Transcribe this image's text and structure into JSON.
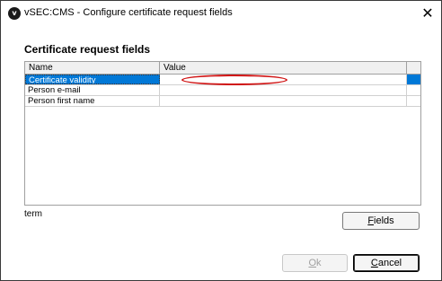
{
  "window": {
    "title": "vSEC:CMS - Configure certificate request fields",
    "app_icon_glyph": "v",
    "close_glyph": "✕"
  },
  "section_title": "Certificate request fields",
  "grid": {
    "columns": [
      "Name",
      "Value",
      ""
    ],
    "rows": [
      {
        "name": "Certificate validity",
        "value": "",
        "selected": true
      },
      {
        "name": "Person e-mail",
        "value": "",
        "selected": false
      },
      {
        "name": "Person first name",
        "value": "",
        "selected": false
      }
    ]
  },
  "status_text": "term",
  "buttons": {
    "fields_first": "F",
    "fields_rest": "ields",
    "ok_first": "O",
    "ok_rest": "k",
    "cancel_first": "C",
    "cancel_rest": "ancel"
  },
  "colors": {
    "selection": "#0078d7",
    "annotation": "#d01414"
  }
}
